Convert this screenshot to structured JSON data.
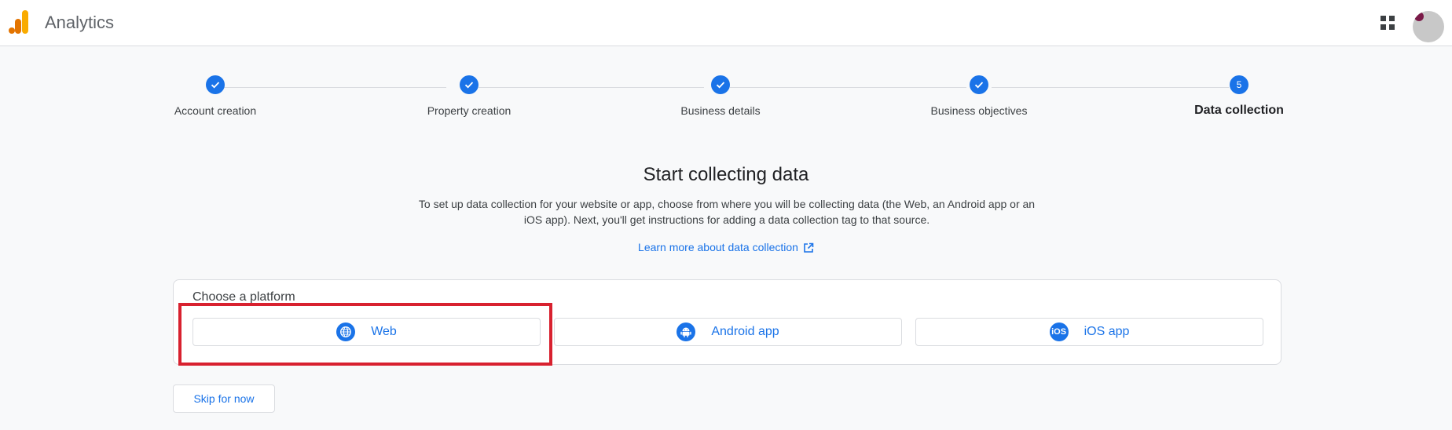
{
  "header": {
    "app_title": "Analytics",
    "logo_icon": "analytics-logo-icon",
    "apps_icon": "apps-grid-icon",
    "avatar_icon": "user-avatar"
  },
  "stepper": {
    "steps": [
      {
        "label": "Account creation",
        "status": "complete",
        "indicator": "check-icon"
      },
      {
        "label": "Property creation",
        "status": "complete",
        "indicator": "check-icon"
      },
      {
        "label": "Business details",
        "status": "complete",
        "indicator": "check-icon"
      },
      {
        "label": "Business objectives",
        "status": "complete",
        "indicator": "check-icon"
      },
      {
        "label": "Data collection",
        "status": "current",
        "number": "5"
      }
    ]
  },
  "main": {
    "heading": "Start collecting data",
    "description": "To set up data collection for your website or app, choose from where you will be collecting data (the Web, an Android app or an iOS app). Next, you'll get instructions for adding a data collection tag to that source.",
    "learn_more_link": "Learn more about data collection"
  },
  "platform": {
    "title": "Choose a platform",
    "options": [
      {
        "label": "Web",
        "icon": "globe-icon"
      },
      {
        "label": "Android app",
        "icon": "android-icon"
      },
      {
        "label": "iOS app",
        "icon": "ios-icon",
        "icon_text": "iOS"
      }
    ]
  },
  "footer": {
    "skip_label": "Skip for now"
  },
  "colors": {
    "accent": "#1a73e8",
    "highlight": "#d8212f",
    "logo_orange": "#f9ab00",
    "logo_dark_orange": "#e37400"
  }
}
